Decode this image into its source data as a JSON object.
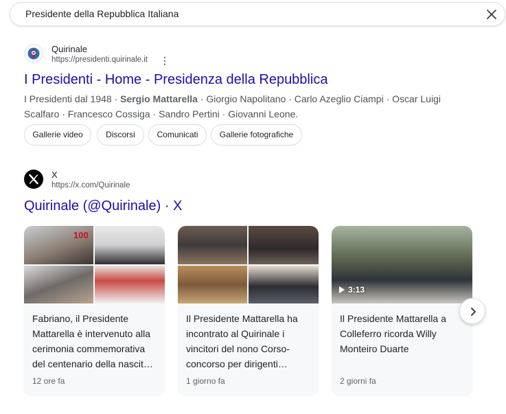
{
  "search": {
    "query": "Presidente della Repubblica Italiana"
  },
  "results": [
    {
      "site_name": "Quirinale",
      "url": "https://presidenti.quirinale.it",
      "title": "I Presidenti - Home - Presidenza della Repubblica",
      "snippet_before": "I Presidenti dal 1948 · ",
      "snippet_bold": "Sergio Mattarella",
      "snippet_after": " · Giorgio Napolitano · Carlo Azeglio Ciampi · Oscar Luigi Scalfaro · Francesco Cossiga · Sandro Pertini · Giovanni Leone.",
      "chips": [
        "Gallerie video",
        "Discorsi",
        "Comunicati",
        "Gallerie fotografiche"
      ]
    },
    {
      "site_name": "X",
      "url": "https://x.com/Quirinale",
      "title": "Quirinale (@Quirinale) · X"
    }
  ],
  "cards": [
    {
      "text": "Fabriano, il Presidente Mattarella è intervenuto alla cerimonia commemorativa del centenario della nascit…",
      "time": "12 ore fa"
    },
    {
      "text": "Il Presidente Mattarella ha incontrato al Quirinale i vincitori del nono Corso-concorso per dirigenti…",
      "time": "1 giorno fa"
    },
    {
      "text": "Il Presidente Mattarella a Colleferro ricorda Willy Monteiro Duarte",
      "time": "2 giorni fa",
      "duration": "3:13"
    }
  ],
  "media_overlay": {
    "centenary_badge": "100"
  },
  "colors": {
    "link": "#1a0dab",
    "snippet": "#4d5156",
    "card_bg": "#f7f8f9",
    "chip_border": "#dadce0"
  },
  "icons": {
    "clear": "close-icon",
    "more": "more-vert-icon",
    "next": "chevron-right-icon",
    "play": "play-icon"
  }
}
